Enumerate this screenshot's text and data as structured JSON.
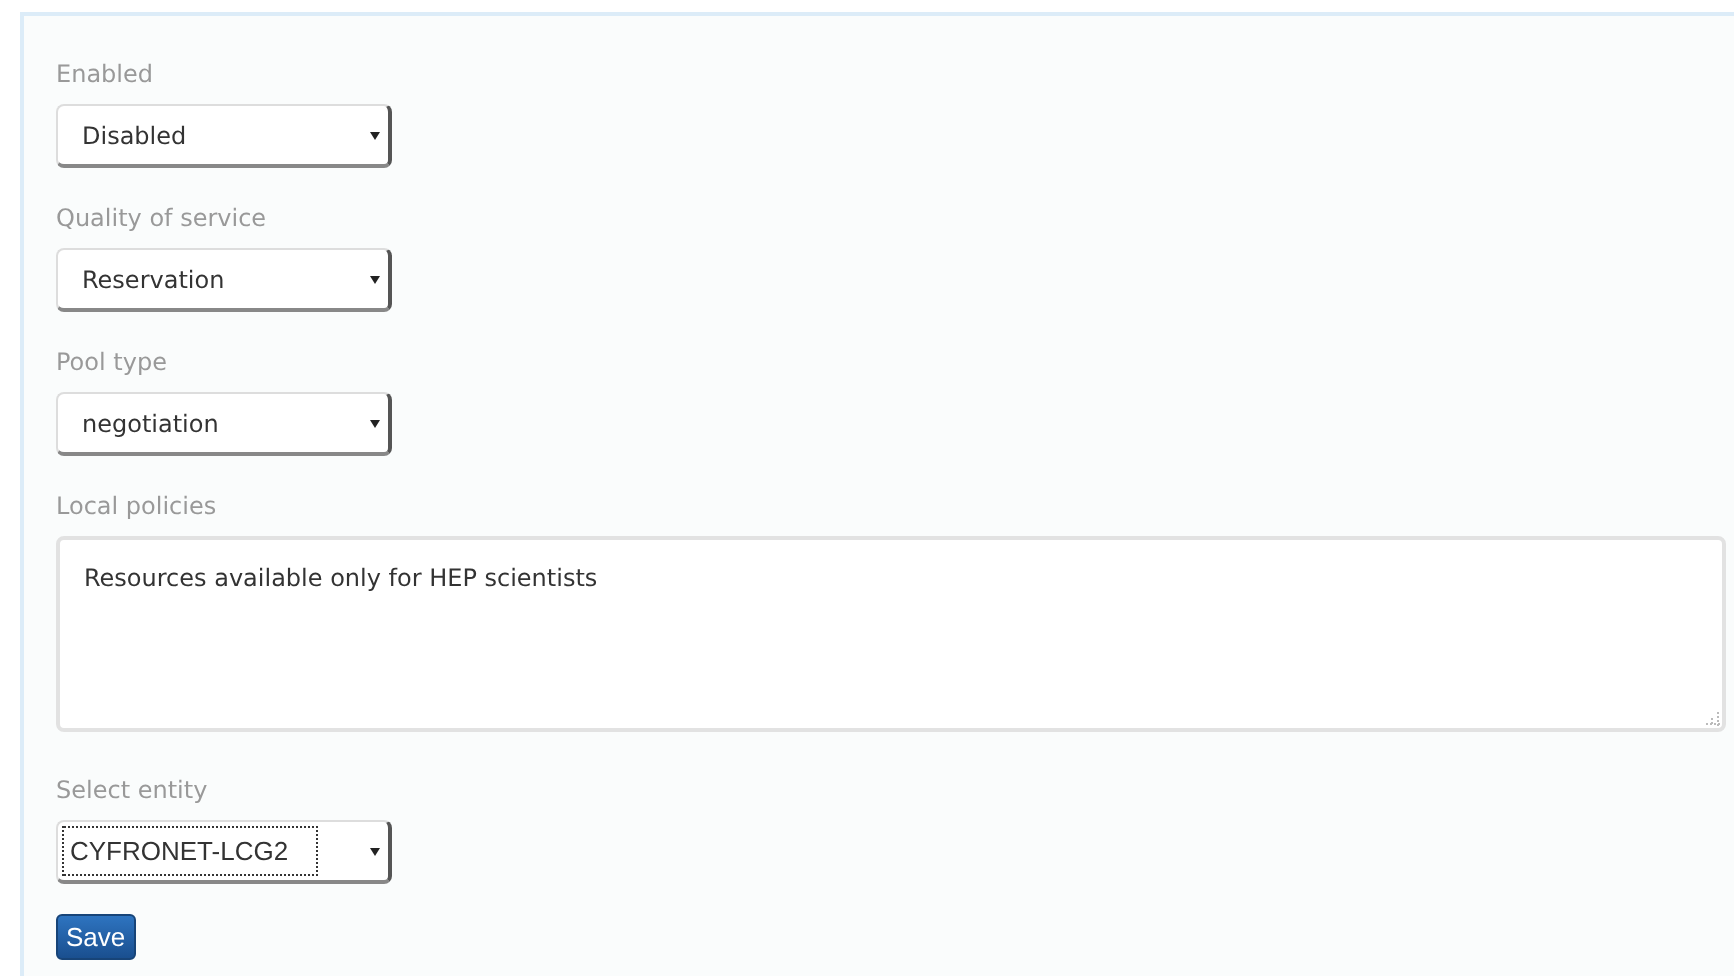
{
  "fields": [
    {
      "label": "Enabled",
      "kind": "select",
      "value": "Disabled",
      "focused": false
    },
    {
      "label": "Quality of service",
      "kind": "select",
      "value": "Reservation",
      "focused": false
    },
    {
      "label": "Pool type",
      "kind": "select",
      "value": "negotiation",
      "focused": false
    },
    {
      "label": "Local policies",
      "kind": "textarea",
      "value": "Resources available only for HEP scientists",
      "focused": false
    },
    {
      "label": "Select entity",
      "kind": "select",
      "value": "CYFRONET-LCG2",
      "focused": true
    }
  ],
  "save_button": "Save"
}
